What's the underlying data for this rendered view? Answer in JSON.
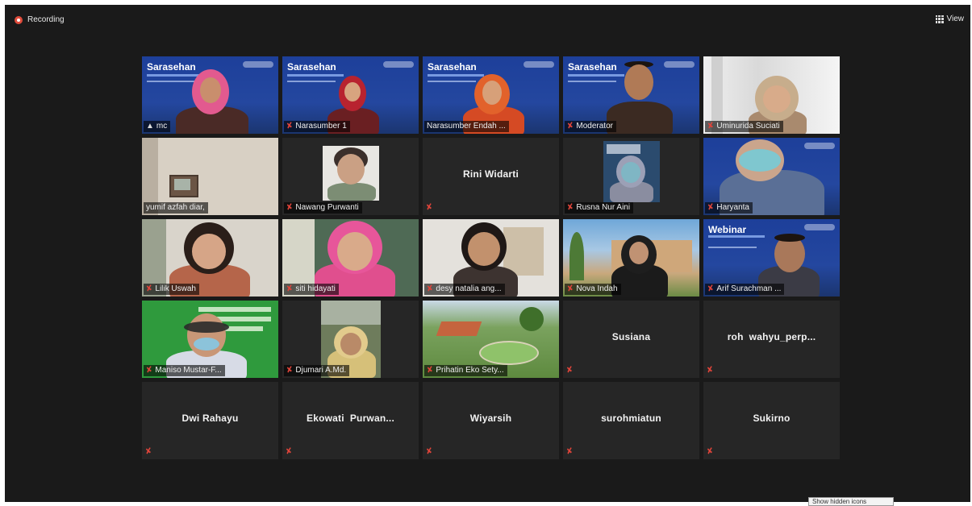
{
  "topbar": {
    "recording_label": "Recording",
    "view_label": "View"
  },
  "participants": [
    {
      "name": "mc",
      "video": true
    },
    {
      "name": "Narasumber 1",
      "video": true
    },
    {
      "name": "Narasumber Endah ...",
      "video": true
    },
    {
      "name": "Moderator",
      "video": true
    },
    {
      "name": "Uminurida Suciati",
      "video": true
    },
    {
      "name": "yumif azfah diar,",
      "video": true
    },
    {
      "name": "Nawang Purwanti",
      "video": true
    },
    {
      "name": "Rini Widarti",
      "video": false
    },
    {
      "name": "Rusna Nur Aini",
      "video": true
    },
    {
      "name": "Haryanta",
      "video": true
    },
    {
      "name": "Lilik Uswah",
      "video": true
    },
    {
      "name": "siti hidayati",
      "video": true
    },
    {
      "name": "desy natalia ang...",
      "video": true
    },
    {
      "name": "Nova Indah",
      "video": true
    },
    {
      "name": "Arif Surachman ...",
      "video": true
    },
    {
      "name": "Maniso Mustar-F...",
      "video": true
    },
    {
      "name": "Djumari A.Md.",
      "video": true
    },
    {
      "name": "Prihatin Eko Sety...",
      "video": true
    },
    {
      "name": "Susiana",
      "video": false
    },
    {
      "name": "roh  wahyu_perp...",
      "video": false
    },
    {
      "name": "Dwi Rahayu",
      "video": false
    },
    {
      "name": "Ekowati  Purwan...",
      "video": false
    },
    {
      "name": "Wiyarsih",
      "video": false
    },
    {
      "name": "surohmiatun",
      "video": false
    },
    {
      "name": "Sukirno",
      "video": false
    }
  ],
  "banners": {
    "sarasehan": "Sarasehan",
    "webinar": "Webinar"
  },
  "tooltip": {
    "text": "Show hidden icons"
  },
  "colors": {
    "active_speaker": "#c8e64a",
    "recording": "#e04b3b",
    "muted_icon": "#e0443a",
    "background": "#1a1a1a"
  }
}
